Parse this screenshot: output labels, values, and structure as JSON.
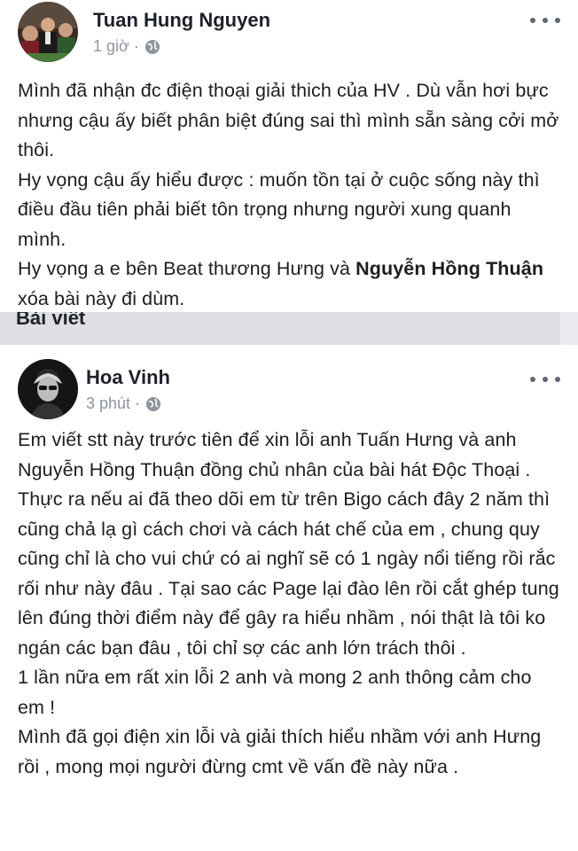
{
  "post1": {
    "author": "Tuan Hung Nguyen",
    "time": "1 giờ ·",
    "paragraphs": [
      "Mình đã nhận đc điện thoại giải thich của HV . Dù vẫn hơi bực nhưng cậu ấy biết phân biệt đúng sai thì mình sẵn sàng cởi mở thôi.",
      "Hy vọng cậu ấy hiểu được : muốn tồn tại ở cuộc sống này thì điều đầu tiên phải biết tôn trọng nhưng  người xung quanh mình."
    ],
    "last_para_prefix": "Hy vọng a e bên Beat thương Hưng và ",
    "mention": "Nguyễn Hồng Thuận",
    "last_para_suffix": " xóa bài này đi dùm."
  },
  "separator_label": "Bài viết",
  "post2": {
    "author": "Hoa Vinh",
    "time": "3 phút ·",
    "paragraphs": [
      "Em viết stt này trước tiên để xin lỗi anh Tuấn Hưng và anh Nguyễn Hồng Thuận đồng chủ nhân của bài hát Độc Thoại . Thực ra nếu ai đã theo dõi em từ trên Bigo cách đây 2 năm thì cũng chả lạ gì cách chơi và cách hát chế của em , chung quy cũng chỉ là cho vui chứ có ai nghĩ sẽ có 1 ngày nổi tiếng rồi rắc rối như này đâu . Tại sao các Page lại đào lên rồi cắt ghép tung lên đúng thời điểm này để gây ra hiểu nhầm , nói thật là tôi ko ngán các bạn đâu , tôi chỉ sợ các anh lớn trách thôi .",
      "1 lần nữa em rất xin lỗi 2 anh và mong 2 anh thông cảm cho em !",
      "Mình đã gọi điện xin lỗi và giải thích hiểu nhầm với anh Hưng rồi , mong mọi người đừng cmt về vấn đề này nữa ."
    ]
  },
  "icons": {
    "globe": "globe-icon",
    "more": "more-options-icon"
  },
  "colors": {
    "text": "#1c1e21",
    "meta": "#8d949e",
    "separator": "#dddfe2"
  }
}
